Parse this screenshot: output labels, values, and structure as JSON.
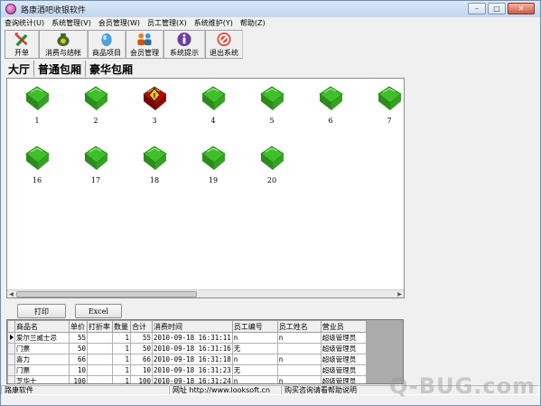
{
  "window": {
    "title": "路康酒吧收银软件"
  },
  "menu": [
    "查询统计(U)",
    "系统管理(V)",
    "会员管理(W)",
    "员工管理(X)",
    "系统维护(Y)",
    "帮助(Z)"
  ],
  "toolbar": [
    {
      "label": "开单",
      "icon": "open-order-icon"
    },
    {
      "label": "消费与结帐",
      "icon": "money-bag-icon"
    },
    {
      "label": "商品项目",
      "icon": "products-icon"
    },
    {
      "label": "会员管理",
      "icon": "members-icon"
    },
    {
      "label": "系统提示",
      "icon": "info-icon"
    },
    {
      "label": "退出系统",
      "icon": "exit-icon"
    }
  ],
  "tabs": [
    "大厅",
    "普通包厢",
    "豪华包厢"
  ],
  "tables": [
    {
      "num": "1",
      "status": "free"
    },
    {
      "num": "2",
      "status": "free"
    },
    {
      "num": "3",
      "status": "occupied"
    },
    {
      "num": "4",
      "status": "free"
    },
    {
      "num": "5",
      "status": "free"
    },
    {
      "num": "6",
      "status": "free"
    },
    {
      "num": "7",
      "status": "free"
    },
    {
      "num": "16",
      "status": "free"
    },
    {
      "num": "17",
      "status": "free"
    },
    {
      "num": "18",
      "status": "free"
    },
    {
      "num": "19",
      "status": "free"
    },
    {
      "num": "20",
      "status": "free"
    }
  ],
  "buttons": {
    "print": "打印",
    "excel": "Excel"
  },
  "grid": {
    "columns": [
      "商品名",
      "单价",
      "打折率",
      "数量",
      "合计",
      "消费时间",
      "员工编号",
      "员工姓名",
      "营业员"
    ],
    "rows": [
      [
        "爱尔兰威士忌",
        "55",
        "",
        "1",
        "55",
        "2010-09-18 16:31:11",
        "n",
        "n",
        "超级管理员"
      ],
      [
        "门票",
        "50",
        "",
        "1",
        "50",
        "2010-09-18 16:31:16",
        "无",
        "",
        "超级管理员"
      ],
      [
        "喜力",
        "66",
        "",
        "1",
        "66",
        "2010-09-18 16:31:18",
        "n",
        "n",
        "超级管理员"
      ],
      [
        "门票",
        "10",
        "",
        "1",
        "10",
        "2010-09-18 16:31:23",
        "无",
        "",
        "超级管理员"
      ],
      [
        "芝华士",
        "100",
        "",
        "1",
        "100",
        "2010-09-18 16:31:24",
        "n",
        "n",
        "超级管理员"
      ]
    ]
  },
  "status": [
    "路康软件",
    "网址 http://www.looksoft.cn",
    "购买咨询请看帮助说明"
  ],
  "watermark": "Q-BUG.com",
  "colors": {
    "free": "#3fbf2a",
    "occupied": "#c40000",
    "accent": "#6e8fb6"
  }
}
